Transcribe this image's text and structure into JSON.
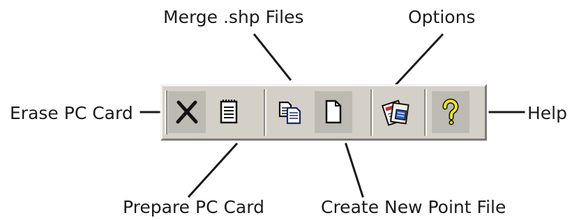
{
  "callouts": {
    "merge": "Merge .shp Files",
    "options": "Options",
    "erase": "Erase PC Card",
    "help": "Help",
    "prepare": "Prepare PC Card",
    "create": "Create New Point File"
  },
  "toolbar": {
    "buttons": [
      {
        "name": "erase-pc-card",
        "icon": "x-delete-icon"
      },
      {
        "name": "prepare-pc-card",
        "icon": "notepad-icon"
      },
      {
        "name": "merge-shp-files",
        "icon": "copy-pages-icon"
      },
      {
        "name": "create-new-point-file",
        "icon": "blank-page-icon"
      },
      {
        "name": "options",
        "icon": "options-cards-icon"
      },
      {
        "name": "help",
        "icon": "question-mark-icon"
      }
    ]
  },
  "colors": {
    "toolbar_face": "#d4d0c8",
    "help_yellow": "#f3e51a",
    "options_red": "#d42a2a",
    "options_blue": "#2f5fd1"
  }
}
